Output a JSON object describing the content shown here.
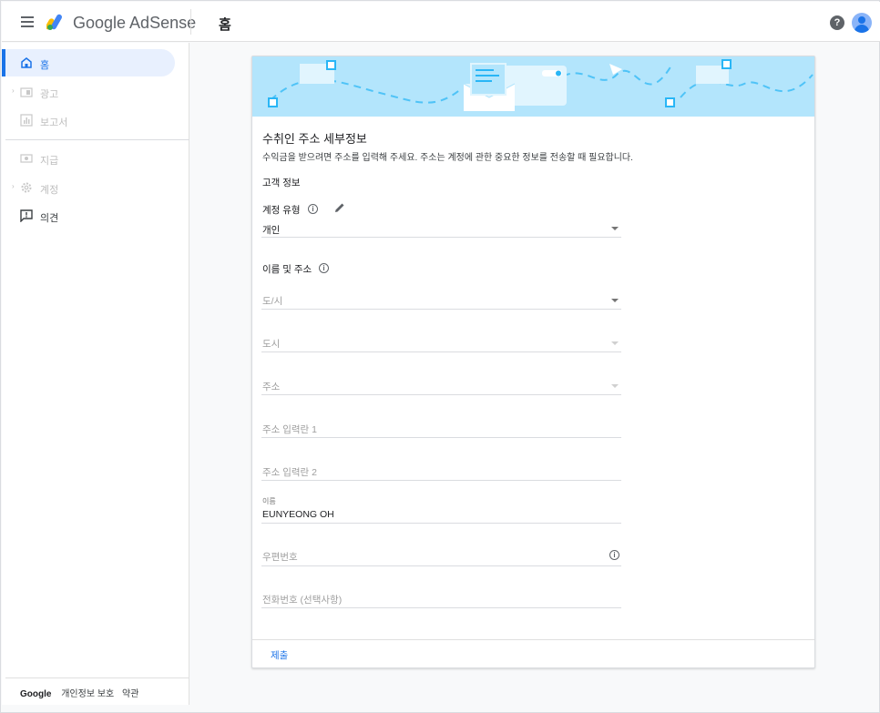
{
  "app": {
    "brand": "Google AdSense",
    "page_title": "홈",
    "help_icon": "?"
  },
  "sidebar": {
    "items": [
      {
        "label": "홈",
        "icon": "home-icon",
        "active": true
      },
      {
        "label": "광고",
        "icon": "ads-icon",
        "has_caret": true
      },
      {
        "label": "보고서",
        "icon": "reports-icon"
      },
      {
        "label": "지급",
        "icon": "payments-icon"
      },
      {
        "label": "계정",
        "icon": "gear-icon",
        "has_caret": true
      },
      {
        "label": "의견",
        "icon": "feedback-icon",
        "dark": true
      }
    ],
    "caret": "›",
    "footer": {
      "brand": "Google",
      "privacy": "개인정보 보호",
      "terms": "약관"
    }
  },
  "card": {
    "title": "수취인 주소 세부정보",
    "description": "수익금을 받으려면 주소를 입력해 주세요. 주소는 계정에 관한 중요한 정보를 전송할 때 필요합니다.",
    "section_label": "고객 정보",
    "account_type_label": "계정 유형",
    "info_glyph": "i",
    "account_type_value": "개인",
    "name_address_label": "이름 및 주소",
    "fields": {
      "province": "도/시",
      "city": "도시",
      "address": "주소",
      "address_line1": "주소 입력란 1",
      "address_line2": "주소 입력란 2",
      "name_label": "이름",
      "name_value": "EUNYEONG OH",
      "postal_code": "우편번호",
      "phone": "전화번호 (선택사항)"
    },
    "submit_label": "제출"
  },
  "colors": {
    "accent": "#1a73e8",
    "banner": "#b3e5fc",
    "active_bg": "#e8f0fe"
  }
}
